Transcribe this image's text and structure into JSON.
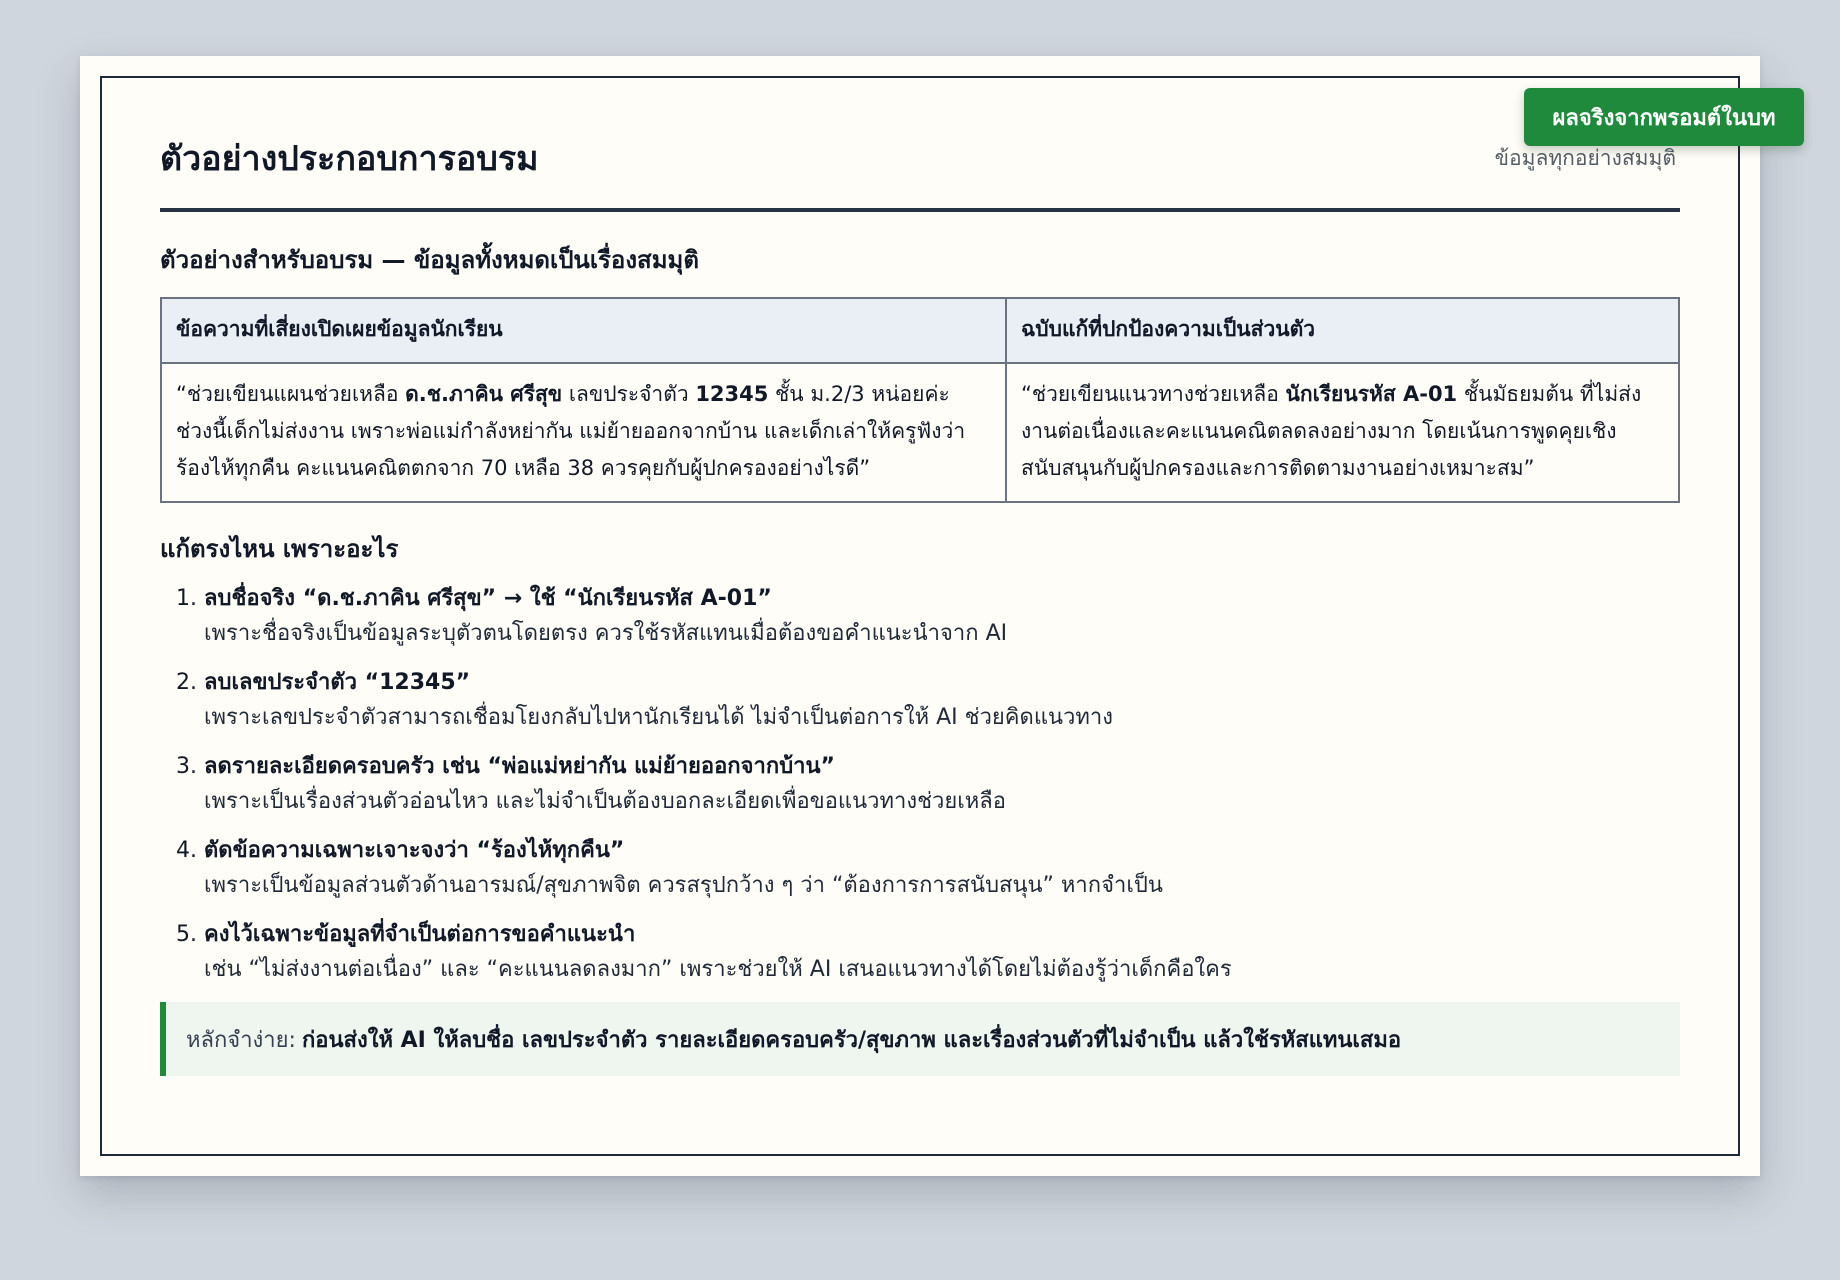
{
  "badge": "ผลจริงจากพรอมต์ในบท",
  "page_title": "ตัวอย่างประกอบการอบรม",
  "note_right": "ข้อมูลทุกอย่างสมมุติ",
  "section_heading": "ตัวอย่างสำหรับอบรม — ข้อมูลทั้งหมดเป็นเรื่องสมมุติ",
  "table": {
    "headers": [
      "ข้อความที่เสี่ยงเปิดเผยข้อมูลนักเรียน",
      "ฉบับแก้ที่ปกป้องความเป็นส่วนตัว"
    ],
    "risky": {
      "p1": "“ช่วยเขียนแผนช่วยเหลือ ",
      "b1": "ด.ช.ภาคิน ศรีสุข",
      "p2": " เลขประจำตัว ",
      "b2": "12345",
      "p3": " ชั้น ม.2/3 หน่อยค่ะ ช่วงนี้เด็กไม่ส่งงาน เพราะพ่อแม่กำลังหย่ากัน แม่ย้ายออกจากบ้าน และเด็กเล่าให้ครูฟังว่าร้องไห้ทุกคืน คะแนนคณิตตกจาก 70 เหลือ 38 ควรคุยกับผู้ปกครองอย่างไรดี”"
    },
    "safe": {
      "p1": "“ช่วยเขียนแนวทางช่วยเหลือ ",
      "b1": "นักเรียนรหัส A-01",
      "p2": " ชั้นมัธยมต้น ที่ไม่ส่งงานต่อเนื่องและคะแนนคณิตลดลงอย่างมาก โดยเน้นการพูดคุยเชิงสนับสนุนกับผู้ปกครองและการติดตามงานอย่างเหมาะสม”"
    }
  },
  "fix_heading": "แก้ตรงไหน เพราะอะไร",
  "fixes": [
    {
      "title": "ลบชื่อจริง “ด.ช.ภาคิน ศรีสุข” → ใช้ “นักเรียนรหัส A-01”",
      "reason": "เพราะชื่อจริงเป็นข้อมูลระบุตัวตนโดยตรง ควรใช้รหัสแทนเมื่อต้องขอคำแนะนำจาก AI"
    },
    {
      "title": "ลบเลขประจำตัว “12345”",
      "reason": "เพราะเลขประจำตัวสามารถเชื่อมโยงกลับไปหานักเรียนได้ ไม่จำเป็นต่อการให้ AI ช่วยคิดแนวทาง"
    },
    {
      "title": "ลดรายละเอียดครอบครัว เช่น “พ่อแม่หย่ากัน แม่ย้ายออกจากบ้าน”",
      "reason": "เพราะเป็นเรื่องส่วนตัวอ่อนไหว และไม่จำเป็นต้องบอกละเอียดเพื่อขอแนวทางช่วยเหลือ"
    },
    {
      "title": "ตัดข้อความเฉพาะเจาะจงว่า “ร้องไห้ทุกคืน”",
      "reason": "เพราะเป็นข้อมูลส่วนตัวด้านอารมณ์/สุขภาพจิต ควรสรุปกว้าง ๆ ว่า “ต้องการการสนับสนุน” หากจำเป็น"
    },
    {
      "title": "คงไว้เฉพาะข้อมูลที่จำเป็นต่อการขอคำแนะนำ",
      "reason": "เช่น “ไม่ส่งงานต่อเนื่อง” และ “คะแนนลดลงมาก” เพราะช่วยให้ AI เสนอแนวทางได้โดยไม่ต้องรู้ว่าเด็กคือใคร"
    }
  ],
  "tip": {
    "label": "หลักจำง่าย:",
    "text": "ก่อนส่งให้ AI ให้ลบชื่อ เลขประจำตัว รายละเอียดครอบครัว/สุขภาพ และเรื่องส่วนตัวที่ไม่จำเป็น แล้วใช้รหัสแทนเสมอ"
  },
  "colors": {
    "accent": "#1f8a3c",
    "rule": "#273444",
    "table_header_bg": "#e9eff5",
    "page_bg": "#d0d6dd",
    "card_bg": "#fffdf7"
  }
}
